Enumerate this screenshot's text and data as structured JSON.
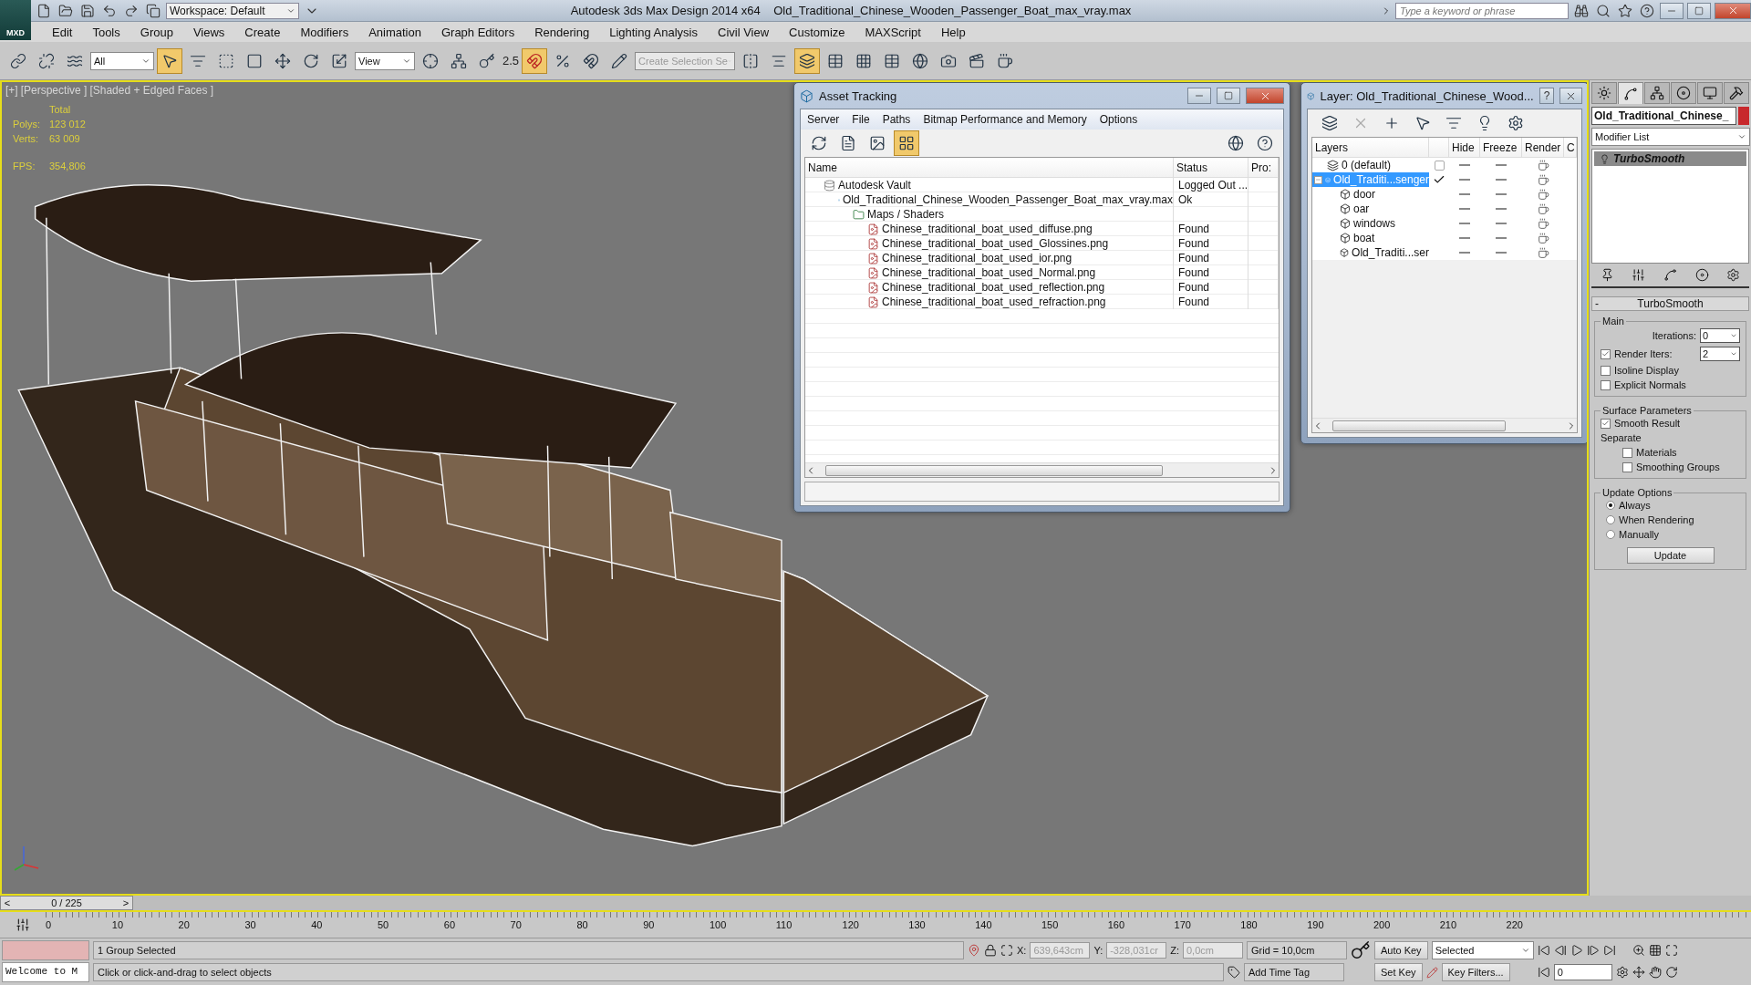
{
  "app": {
    "logo": "MXD",
    "workspace": "Workspace: Default",
    "product": "Autodesk 3ds Max Design 2014 x64",
    "file": "Old_Traditional_Chinese_Wooden_Passenger_Boat_max_vray.max",
    "search": {
      "placeholder": "Type a keyword or phrase"
    }
  },
  "menu": [
    "Edit",
    "Tools",
    "Group",
    "Views",
    "Create",
    "Modifiers",
    "Animation",
    "Graph Editors",
    "Rendering",
    "Lighting Analysis",
    "Civil View",
    "Customize",
    "MAXScript",
    "Help"
  ],
  "toolbar": {
    "selection_filter": "All",
    "reference_coord": "View",
    "snap_angle": "2.5",
    "named_selection": {
      "placeholder": "Create Selection Se"
    }
  },
  "viewport": {
    "labels": [
      "[+]",
      "[Perspective ]",
      "[Shaded + Edged Faces ]"
    ],
    "stats": {
      "header": "Total",
      "rows": [
        {
          "label": "Polys:",
          "value": "123 012"
        },
        {
          "label": "Verts:",
          "value": "63 009"
        }
      ],
      "fps": {
        "label": "FPS:",
        "value": "354,806"
      }
    }
  },
  "asset_tracking": {
    "title": "Asset Tracking",
    "menu": [
      "Server",
      "File",
      "Paths",
      "Bitmap Performance and Memory",
      "Options"
    ],
    "tools": [
      {
        "kind": "refresh",
        "selected": false
      },
      {
        "kind": "list",
        "selected": false
      },
      {
        "kind": "thumbnails",
        "selected": false
      },
      {
        "kind": "table",
        "selected": true
      }
    ],
    "columns": [
      "Name",
      "Status",
      "Pro:"
    ],
    "rows": [
      {
        "kind": "vault",
        "name": "Autodesk Vault",
        "status": "Logged Out ...",
        "children": [
          {
            "kind": "scene",
            "name": "Old_Traditional_Chinese_Wooden_Passenger_Boat_max_vray.max",
            "status": "Ok",
            "children": [
              {
                "kind": "folder",
                "name": "Maps / Shaders",
                "children": [
                  {
                    "kind": "image",
                    "name": "Chinese_traditional_boat_used_diffuse.png",
                    "status": "Found"
                  },
                  {
                    "kind": "image",
                    "name": "Chinese_traditional_boat_used_Glossines.png",
                    "status": "Found"
                  },
                  {
                    "kind": "image",
                    "name": "Chinese_traditional_boat_used_ior.png",
                    "status": "Found"
                  },
                  {
                    "kind": "image",
                    "name": "Chinese_traditional_boat_used_Normal.png",
                    "status": "Found"
                  },
                  {
                    "kind": "image",
                    "name": "Chinese_traditional_boat_used_reflection.png",
                    "status": "Found"
                  },
                  {
                    "kind": "image",
                    "name": "Chinese_traditional_boat_used_refraction.png",
                    "status": "Found"
                  }
                ]
              }
            ]
          }
        ]
      }
    ]
  },
  "layer_manager": {
    "title": "Layer: Old_Traditional_Chinese_Wood...",
    "help": "?",
    "columns": [
      "Layers",
      "Hide",
      "Freeze",
      "Render",
      "C"
    ],
    "layers": [
      {
        "name": "0 (default)",
        "current": false,
        "selected": false
      },
      {
        "name": "Old_Traditi...senger",
        "current": true,
        "selected": true,
        "expanded": true,
        "children": [
          {
            "name": "door"
          },
          {
            "name": "oar"
          },
          {
            "name": "windows"
          },
          {
            "name": "boat"
          },
          {
            "name": "Old_Traditi...ser"
          }
        ]
      }
    ]
  },
  "command_panel": {
    "tabs": [
      {
        "kind": "create",
        "selected": false
      },
      {
        "kind": "modify",
        "selected": true
      },
      {
        "kind": "hierarchy",
        "selected": false
      },
      {
        "kind": "motion",
        "selected": false
      },
      {
        "kind": "display",
        "selected": false
      },
      {
        "kind": "utilities",
        "selected": false
      }
    ],
    "object_name": "Old_Traditional_Chinese_",
    "modifier_list": "Modifier List",
    "stack": [
      {
        "name": "TurboSmooth",
        "selected": true
      }
    ],
    "rollout": {
      "toggle": "-",
      "title": "TurboSmooth",
      "groups": [
        {
          "title": "Main",
          "items": [
            {
              "kind": "spinner",
              "label": "Iterations:",
              "value": "0"
            },
            {
              "kind": "check_spinner",
              "label": "Render Iters:",
              "checked": true,
              "value": "2"
            },
            {
              "kind": "checkbox",
              "label": "Isoline Display",
              "checked": false
            },
            {
              "kind": "checkbox",
              "label": "Explicit Normals",
              "checked": false
            }
          ]
        },
        {
          "title": "Surface Parameters",
          "items": [
            {
              "kind": "checkbox",
              "label": "Smooth Result",
              "checked": true
            },
            {
              "kind": "label",
              "label": "Separate"
            },
            {
              "kind": "sub_checkbox",
              "label": "Materials",
              "checked": false
            },
            {
              "kind": "sub_checkbox",
              "label": "Smoothing Groups",
              "checked": false
            }
          ]
        },
        {
          "title": "Update Options",
          "items": [
            {
              "kind": "radio",
              "label": "Always",
              "selected": true
            },
            {
              "kind": "radio",
              "label": "When Rendering",
              "selected": false
            },
            {
              "kind": "radio",
              "label": "Manually",
              "selected": false
            },
            {
              "kind": "button",
              "label": "Update"
            }
          ]
        }
      ]
    }
  },
  "timeline": {
    "level": 0,
    "prev": "<",
    "position": "0 / 225",
    "next": ">",
    "ticks": [
      "0",
      "10",
      "20",
      "30",
      "40",
      "50",
      "60",
      "70",
      "80",
      "90",
      "100",
      "110",
      "120",
      "130",
      "140",
      "150",
      "160",
      "170",
      "180",
      "190",
      "200",
      "210",
      "220"
    ]
  },
  "status": {
    "listener": "Welcome to M",
    "selection": "1 Group Selected",
    "prompt": "Click or click-and-drag to select objects",
    "coords_disabled": true,
    "coords": [
      {
        "label": "X:",
        "value": "639,643cm"
      },
      {
        "label": "Y:",
        "value": "-328,031cr"
      },
      {
        "label": "Z:",
        "value": "0,0cm"
      }
    ],
    "grid": "Grid = 10,0cm",
    "time_tag": "Add Time Tag",
    "auto_key": "Auto Key",
    "set_key": "Set Key",
    "key_mode": "Selected",
    "key_filters": "Key Filters...",
    "frame": "0"
  }
}
